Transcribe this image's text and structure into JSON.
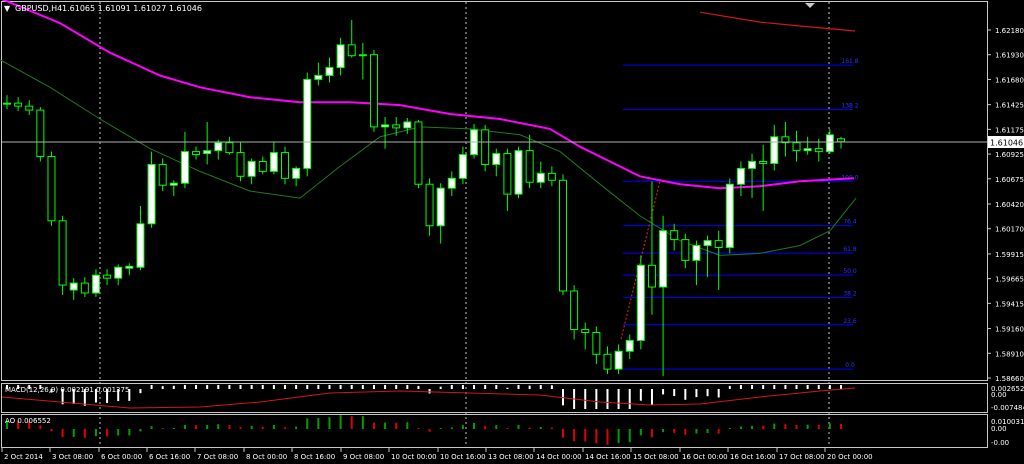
{
  "title": {
    "symbol": "GBPUSD,H4",
    "ohlc": "1.61065 1.61091 1.61027 1.61046"
  },
  "colors": {
    "background": "#000000",
    "grid": "#c8c8c8",
    "bull_candle": "#ffffff",
    "bear_candle": "#000000",
    "candle_outline": "#00ff00",
    "ma_fast": "#ff00ff",
    "ma_slow": "#1f7a1f",
    "ma_long": "#d01818",
    "fibo": "#0000ff",
    "fibo_label": "#3030ff",
    "price_line": "#c0c0c0",
    "macd_hist": "#ffffff",
    "macd_signal": "#d01818",
    "ao_up": "#00a000",
    "ao_down": "#e00000",
    "text": "#ffffff"
  },
  "price_axis": {
    "ticks": [
      "1.62180",
      "1.61930",
      "1.61680",
      "1.61425",
      "1.61175",
      "1.60925",
      "1.60675",
      "1.60420",
      "1.60170",
      "1.59915",
      "1.59665",
      "1.59415",
      "1.59160",
      "1.58910",
      "1.58660"
    ],
    "current": "1.61046"
  },
  "time_axis": {
    "labels": [
      "2 Oct 2014",
      "3 Oct 08:00",
      "6 Oct 00:00",
      "6 Oct 16:00",
      "7 Oct 08:00",
      "8 Oct 00:00",
      "8 Oct 16:00",
      "9 Oct 08:00",
      "10 Oct 00:00",
      "10 Oct 16:00",
      "13 Oct 08:00",
      "14 Oct 00:00",
      "14 Oct 16:00",
      "15 Oct 08:00",
      "16 Oct 00:00",
      "16 Oct 16:00",
      "17 Oct 08:00",
      "20 Oct 00:00"
    ]
  },
  "fibo_levels": [
    "161.8",
    "138.2",
    "100.0",
    "76.4",
    "61.8",
    "50.0",
    "38.2",
    "23.6",
    "0.0"
  ],
  "macd": {
    "label": "MACD(12,26,9) 0.002191 0.001375",
    "axis": [
      "0.002652",
      "0.00",
      "-0.007484"
    ]
  },
  "ao": {
    "label": "AO 0.006552",
    "axis": [
      "0.010031",
      "0.00",
      "-0.00"
    ]
  },
  "chart_data": {
    "type": "candlestick",
    "symbol": "GBPUSD",
    "timeframe": "H4",
    "categories": [
      "2 Oct 2014",
      "3 Oct 08:00",
      "6 Oct 00:00",
      "6 Oct 16:00",
      "7 Oct 08:00",
      "8 Oct 00:00",
      "8 Oct 16:00",
      "9 Oct 08:00",
      "10 Oct 00:00",
      "10 Oct 16:00",
      "13 Oct 08:00",
      "14 Oct 00:00",
      "14 Oct 16:00",
      "15 Oct 08:00",
      "16 Oct 00:00",
      "16 Oct 16:00",
      "17 Oct 08:00",
      "20 Oct 00:00"
    ],
    "ylim": [
      1.5866,
      1.6233
    ],
    "candles": [
      [
        1.6143,
        1.6152,
        1.6138,
        1.6144
      ],
      [
        1.6144,
        1.615,
        1.6136,
        1.6141
      ],
      [
        1.6141,
        1.6147,
        1.6132,
        1.6137
      ],
      [
        1.6137,
        1.614,
        1.6085,
        1.609
      ],
      [
        1.609,
        1.6095,
        1.602,
        1.6025
      ],
      [
        1.6025,
        1.603,
        1.595,
        1.596
      ],
      [
        1.5955,
        1.5967,
        1.5945,
        1.5962
      ],
      [
        1.5962,
        1.5968,
        1.5948,
        1.5952
      ],
      [
        1.5952,
        1.5976,
        1.5948,
        1.597
      ],
      [
        1.597,
        1.5976,
        1.596,
        1.5967
      ],
      [
        1.5967,
        1.5981,
        1.596,
        1.5978
      ],
      [
        1.5977,
        1.5982,
        1.597,
        1.5979
      ],
      [
        1.5978,
        1.604,
        1.5975,
        1.6022
      ],
      [
        1.6022,
        1.6095,
        1.6018,
        1.6082
      ],
      [
        1.6082,
        1.6088,
        1.6055,
        1.6061
      ],
      [
        1.6061,
        1.6066,
        1.605,
        1.6063
      ],
      [
        1.6063,
        1.6115,
        1.6058,
        1.6095
      ],
      [
        1.6095,
        1.61,
        1.6087,
        1.6092
      ],
      [
        1.6093,
        1.6125,
        1.6082,
        1.6096
      ],
      [
        1.6096,
        1.6107,
        1.6087,
        1.6104
      ],
      [
        1.6104,
        1.611,
        1.6092,
        1.6094
      ],
      [
        1.6094,
        1.6105,
        1.6065,
        1.607
      ],
      [
        1.607,
        1.6088,
        1.6062,
        1.6085
      ],
      [
        1.6085,
        1.609,
        1.6072,
        1.6075
      ],
      [
        1.6075,
        1.6105,
        1.6072,
        1.6094
      ],
      [
        1.6094,
        1.61,
        1.6062,
        1.6068
      ],
      [
        1.6068,
        1.608,
        1.606,
        1.6078
      ],
      [
        1.6078,
        1.6175,
        1.607,
        1.6168
      ],
      [
        1.6168,
        1.6185,
        1.6162,
        1.6172
      ],
      [
        1.6172,
        1.619,
        1.6165,
        1.618
      ],
      [
        1.618,
        1.621,
        1.6172,
        1.6203
      ],
      [
        1.6203,
        1.6228,
        1.619,
        1.6192
      ],
      [
        1.6192,
        1.6205,
        1.6168,
        1.6193
      ],
      [
        1.6193,
        1.6198,
        1.6115,
        1.612
      ],
      [
        1.612,
        1.613,
        1.6098,
        1.6122
      ],
      [
        1.6122,
        1.613,
        1.6111,
        1.6119
      ],
      [
        1.6119,
        1.6129,
        1.6113,
        1.6125
      ],
      [
        1.6125,
        1.6127,
        1.6058,
        1.6062
      ],
      [
        1.6062,
        1.6068,
        1.601,
        1.602
      ],
      [
        1.602,
        1.6063,
        1.6002,
        1.6058
      ],
      [
        1.6058,
        1.6075,
        1.605,
        1.6068
      ],
      [
        1.6068,
        1.61,
        1.6062,
        1.6092
      ],
      [
        1.6092,
        1.6123,
        1.6088,
        1.6117
      ],
      [
        1.6117,
        1.6122,
        1.6075,
        1.6082
      ],
      [
        1.6082,
        1.6098,
        1.607,
        1.6093
      ],
      [
        1.6093,
        1.6098,
        1.6035,
        1.6052
      ],
      [
        1.6052,
        1.61,
        1.6048,
        1.6096
      ],
      [
        1.6096,
        1.6112,
        1.6058,
        1.6064
      ],
      [
        1.6064,
        1.6085,
        1.6058,
        1.6073
      ],
      [
        1.6073,
        1.608,
        1.606,
        1.6066
      ],
      [
        1.6066,
        1.6072,
        1.595,
        1.5954
      ],
      [
        1.5954,
        1.596,
        1.5905,
        1.5915
      ],
      [
        1.5915,
        1.5922,
        1.5895,
        1.5912
      ],
      [
        1.5912,
        1.5918,
        1.588,
        1.589
      ],
      [
        1.589,
        1.5898,
        1.587,
        1.5875
      ],
      [
        1.5875,
        1.59,
        1.587,
        1.5893
      ],
      [
        1.5893,
        1.591,
        1.5885,
        1.5904
      ],
      [
        1.5904,
        1.599,
        1.5895,
        1.598
      ],
      [
        1.598,
        1.6065,
        1.593,
        1.5958
      ],
      [
        1.5958,
        1.603,
        1.5868,
        1.6015
      ],
      [
        1.6015,
        1.6022,
        1.5995,
        1.6006
      ],
      [
        1.6006,
        1.6012,
        1.5977,
        1.5985
      ],
      [
        1.5985,
        1.6005,
        1.596,
        1.6
      ],
      [
        1.6,
        1.601,
        1.5968,
        1.6005
      ],
      [
        1.6005,
        1.6015,
        1.5955,
        1.5998
      ],
      [
        1.5998,
        1.6068,
        1.5992,
        1.6062
      ],
      [
        1.6062,
        1.6085,
        1.605,
        1.6078
      ],
      [
        1.6078,
        1.6093,
        1.6048,
        1.6085
      ],
      [
        1.6085,
        1.6102,
        1.6035,
        1.6083
      ],
      [
        1.6083,
        1.6122,
        1.6076,
        1.611
      ],
      [
        1.611,
        1.6125,
        1.609,
        1.6104
      ],
      [
        1.6104,
        1.6116,
        1.6085,
        1.6096
      ],
      [
        1.6096,
        1.611,
        1.6092,
        1.6098
      ],
      [
        1.6098,
        1.6108,
        1.6085,
        1.6095
      ],
      [
        1.6095,
        1.6118,
        1.6093,
        1.6112
      ],
      [
        1.6108,
        1.611,
        1.6098,
        1.6105
      ]
    ],
    "ma_fast": [
      [
        0,
        1.625
      ],
      [
        60,
        1.6225
      ],
      [
        110,
        1.6195
      ],
      [
        160,
        1.6172
      ],
      [
        200,
        1.616
      ],
      [
        250,
        1.615
      ],
      [
        300,
        1.6145
      ],
      [
        350,
        1.6145
      ],
      [
        400,
        1.6142
      ],
      [
        450,
        1.6133
      ],
      [
        500,
        1.6128
      ],
      [
        550,
        1.6118
      ],
      [
        580,
        1.61
      ],
      [
        610,
        1.6085
      ],
      [
        640,
        1.607
      ],
      [
        680,
        1.6062
      ],
      [
        720,
        1.6058
      ],
      [
        760,
        1.606
      ],
      [
        800,
        1.6065
      ],
      [
        854,
        1.6068
      ]
    ],
    "ma_slow": [
      [
        0,
        1.6188
      ],
      [
        50,
        1.616
      ],
      [
        100,
        1.6128
      ],
      [
        150,
        1.6098
      ],
      [
        200,
        1.6075
      ],
      [
        250,
        1.6055
      ],
      [
        300,
        1.6048
      ],
      [
        340,
        1.608
      ],
      [
        380,
        1.611
      ],
      [
        420,
        1.612
      ],
      [
        470,
        1.6118
      ],
      [
        520,
        1.6112
      ],
      [
        560,
        1.6095
      ],
      [
        600,
        1.6062
      ],
      [
        640,
        1.603
      ],
      [
        680,
        1.6005
      ],
      [
        720,
        1.599
      ],
      [
        760,
        1.5992
      ],
      [
        800,
        1.6
      ],
      [
        830,
        1.6015
      ],
      [
        856,
        1.6048
      ]
    ],
    "ma_long": [
      [
        700,
        1.6236
      ],
      [
        760,
        1.6226
      ],
      [
        800,
        1.6222
      ],
      [
        855,
        1.6217
      ]
    ],
    "fibo_retracement": {
      "from": 1.5875,
      "to": 1.6065,
      "levels": [
        1.618,
        1.382,
        1.0,
        0.764,
        0.618,
        0.5,
        0.382,
        0.236,
        0.0
      ]
    },
    "series": [
      {
        "name": "MACD(12,26,9)",
        "values": [
          0.002191,
          0.001375
        ]
      },
      {
        "name": "AO",
        "values": [
          0.006552
        ]
      }
    ]
  }
}
